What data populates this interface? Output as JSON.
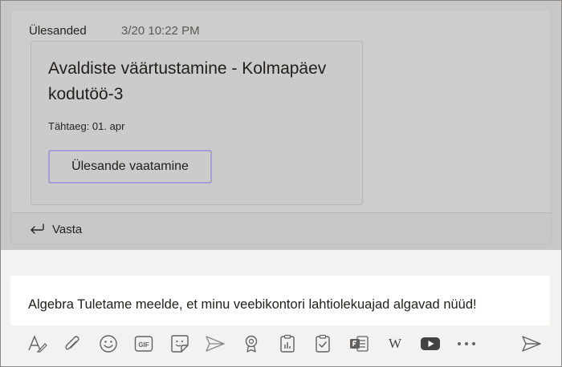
{
  "post": {
    "channel_label": "Ülesanded",
    "timestamp": "3/20 10:22 PM",
    "card": {
      "title": "Avaldiste väärtustamine - Kolmapäev kodutöö-3",
      "due": "Tähtaeg: 01. apr",
      "button_label": "Ülesande vaatamine"
    },
    "reply_label": "Vasta"
  },
  "compose": {
    "text": "Algebra Tuletame meelde, et minu veebikontori lahtiolekuajad algavad nüüd!"
  },
  "toolbar": {
    "icons": [
      "format-icon",
      "attach-icon",
      "emoji-icon",
      "gif-icon",
      "sticker-icon",
      "meet-now-icon",
      "praise-icon",
      "forms-icon",
      "approvals-icon",
      "forms-app-icon",
      "wikipedia-icon",
      "youtube-icon",
      "more-options-icon"
    ],
    "gif_text": "GIF",
    "wiki_text": "W",
    "accent_youtube": "#424242",
    "accent_forms": "#616161"
  }
}
